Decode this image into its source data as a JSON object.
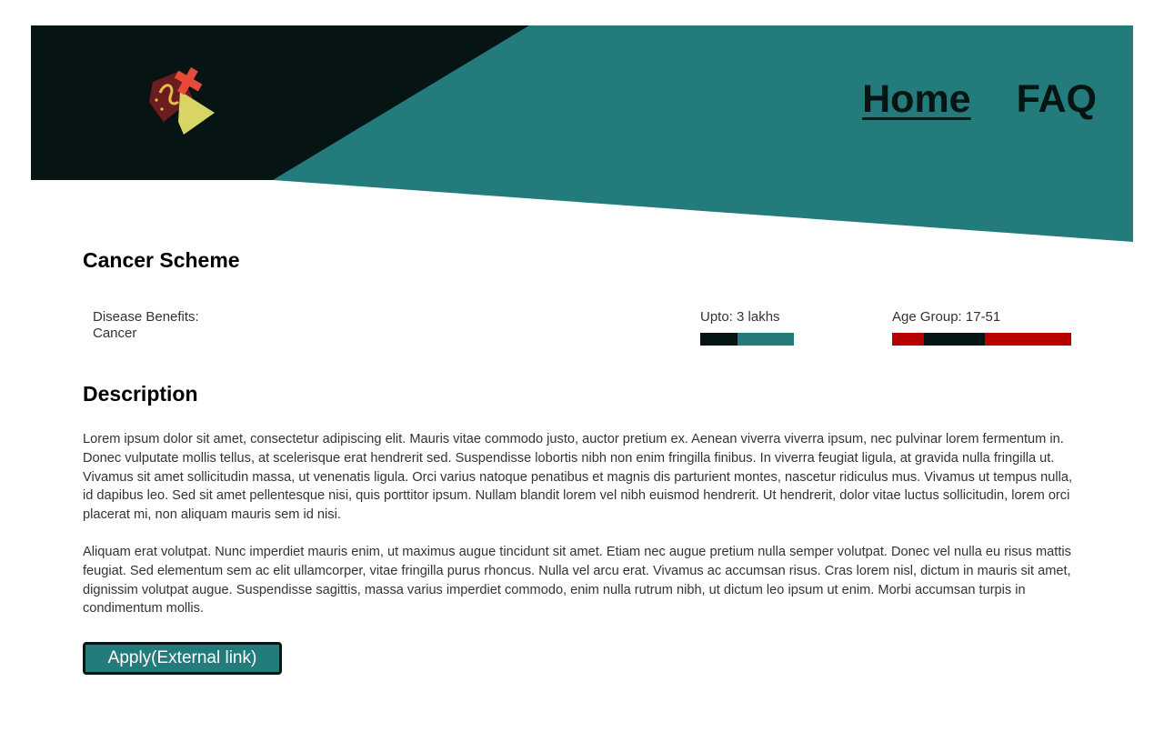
{
  "colors": {
    "dark": "#071414",
    "teal": "#237c7b",
    "red": "#b80000",
    "logo_book": "#6b1d1d",
    "logo_cross": "#e84a3a",
    "logo_flap": "#d8d565"
  },
  "header": {
    "logo_icon": "book-with-cross-logo-icon",
    "nav": {
      "home_label": "Home",
      "faq_label": "FAQ"
    }
  },
  "scheme": {
    "title": "Cancer Scheme",
    "benefits_label": "Disease Benefits:",
    "benefits_value": "Cancer",
    "upto_label": "Upto: 3 lakhs",
    "age_label": "Age Group: 17-51"
  },
  "description": {
    "title": "Description",
    "paragraphs": [
      "Lorem ipsum dolor sit amet, consectetur adipiscing elit. Mauris vitae commodo justo, auctor pretium ex. Aenean viverra viverra ipsum, nec pulvinar lorem fermentum in. Donec vulputate mollis tellus, at scelerisque erat hendrerit sed. Suspendisse lobortis nibh non enim fringilla finibus. In viverra feugiat ligula, at gravida nulla fringilla ut. Vivamus sit amet sollicitudin massa, ut venenatis ligula. Orci varius natoque penatibus et magnis dis parturient montes, nascetur ridiculus mus. Vivamus ut tempus nulla, id dapibus leo. Sed sit amet pellentesque nisi, quis porttitor ipsum. Nullam blandit lorem vel nibh euismod hendrerit. Ut hendrerit, dolor vitae luctus sollicitudin, lorem orci placerat mi, non aliquam mauris sem id nisi.",
      "Aliquam erat volutpat. Nunc imperdiet mauris enim, ut maximus augue tincidunt sit amet. Etiam nec augue pretium nulla semper volutpat. Donec vel nulla eu risus mattis feugiat. Sed elementum sem ac elit ullamcorper, vitae fringilla purus rhoncus. Nulla vel arcu erat. Vivamus ac accumsan risus. Cras lorem nisl, dictum in mauris sit amet, dignissim volutpat augue. Suspendisse sagittis, massa varius imperdiet commodo, enim nulla rutrum nibh, ut dictum leo ipsum ut enim. Morbi accumsan turpis in condimentum mollis."
    ]
  },
  "apply_button": {
    "label": "Apply(External link)"
  }
}
